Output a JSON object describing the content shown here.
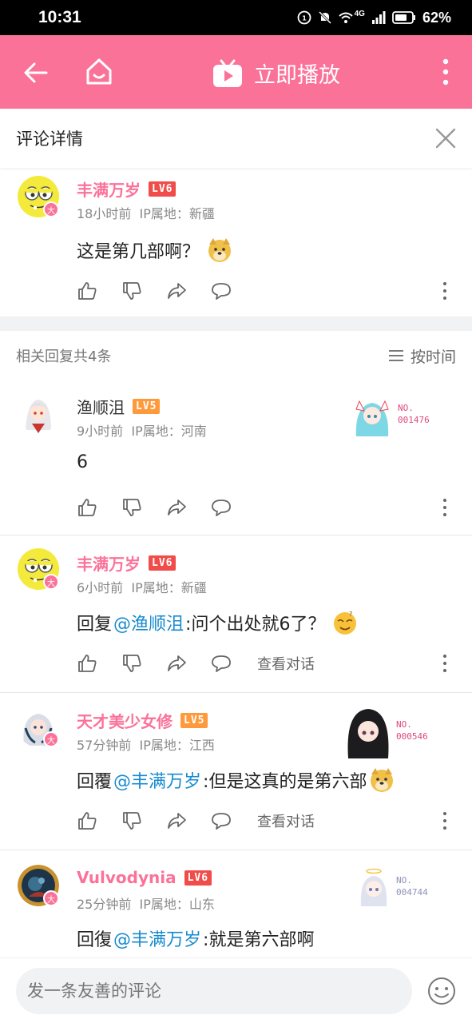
{
  "status_bar": {
    "time": "10:31",
    "battery": "62%",
    "network": "4G"
  },
  "top_bar": {
    "play_label": "立即播放",
    "accent_color": "#fb7299"
  },
  "detail_header": {
    "title": "评论详情"
  },
  "root_comment": {
    "username": "丰满万岁",
    "level": "LV6",
    "badge": "大",
    "time": "18小时前",
    "ip_label": "IP属地：",
    "ip": "新疆",
    "text": "这是第几部啊？"
  },
  "replies_header": {
    "count_text": "相关回复共4条",
    "sort_label": "按时间"
  },
  "replies": [
    {
      "username": "渔顺沮",
      "level": "LV5",
      "time": "9小时前",
      "ip_label": "IP属地：",
      "ip": "河南",
      "text": "6",
      "fan_no": "NO.",
      "fan_num": "001476"
    },
    {
      "username": "丰满万岁",
      "level": "LV6",
      "badge": "大",
      "time": "6小时前",
      "ip_label": "IP属地：",
      "ip": "新疆",
      "prefix": "回复",
      "mention": "@渔顺沮",
      "text": ":问个出处就6了？",
      "view_conv": "查看对话"
    },
    {
      "username": "天才美少女修",
      "level": "LV5",
      "badge": "大",
      "time": "57分钟前",
      "ip_label": "IP属地：",
      "ip": "江西",
      "prefix": "回覆",
      "mention": "@丰满万岁",
      "text": ":但是这真的是第六部",
      "view_conv": "查看对话",
      "fan_no": "NO.",
      "fan_num": "000546"
    },
    {
      "username": "Vulvodynia",
      "level": "LV6",
      "badge": "大",
      "time": "25分钟前",
      "ip_label": "IP属地：",
      "ip": "山东",
      "prefix": "回復",
      "mention": "@丰满万岁",
      "text": ":就是第六部啊",
      "fan_no": "NO.",
      "fan_num": "004744"
    }
  ],
  "input": {
    "placeholder": "发一条友善的评论"
  }
}
